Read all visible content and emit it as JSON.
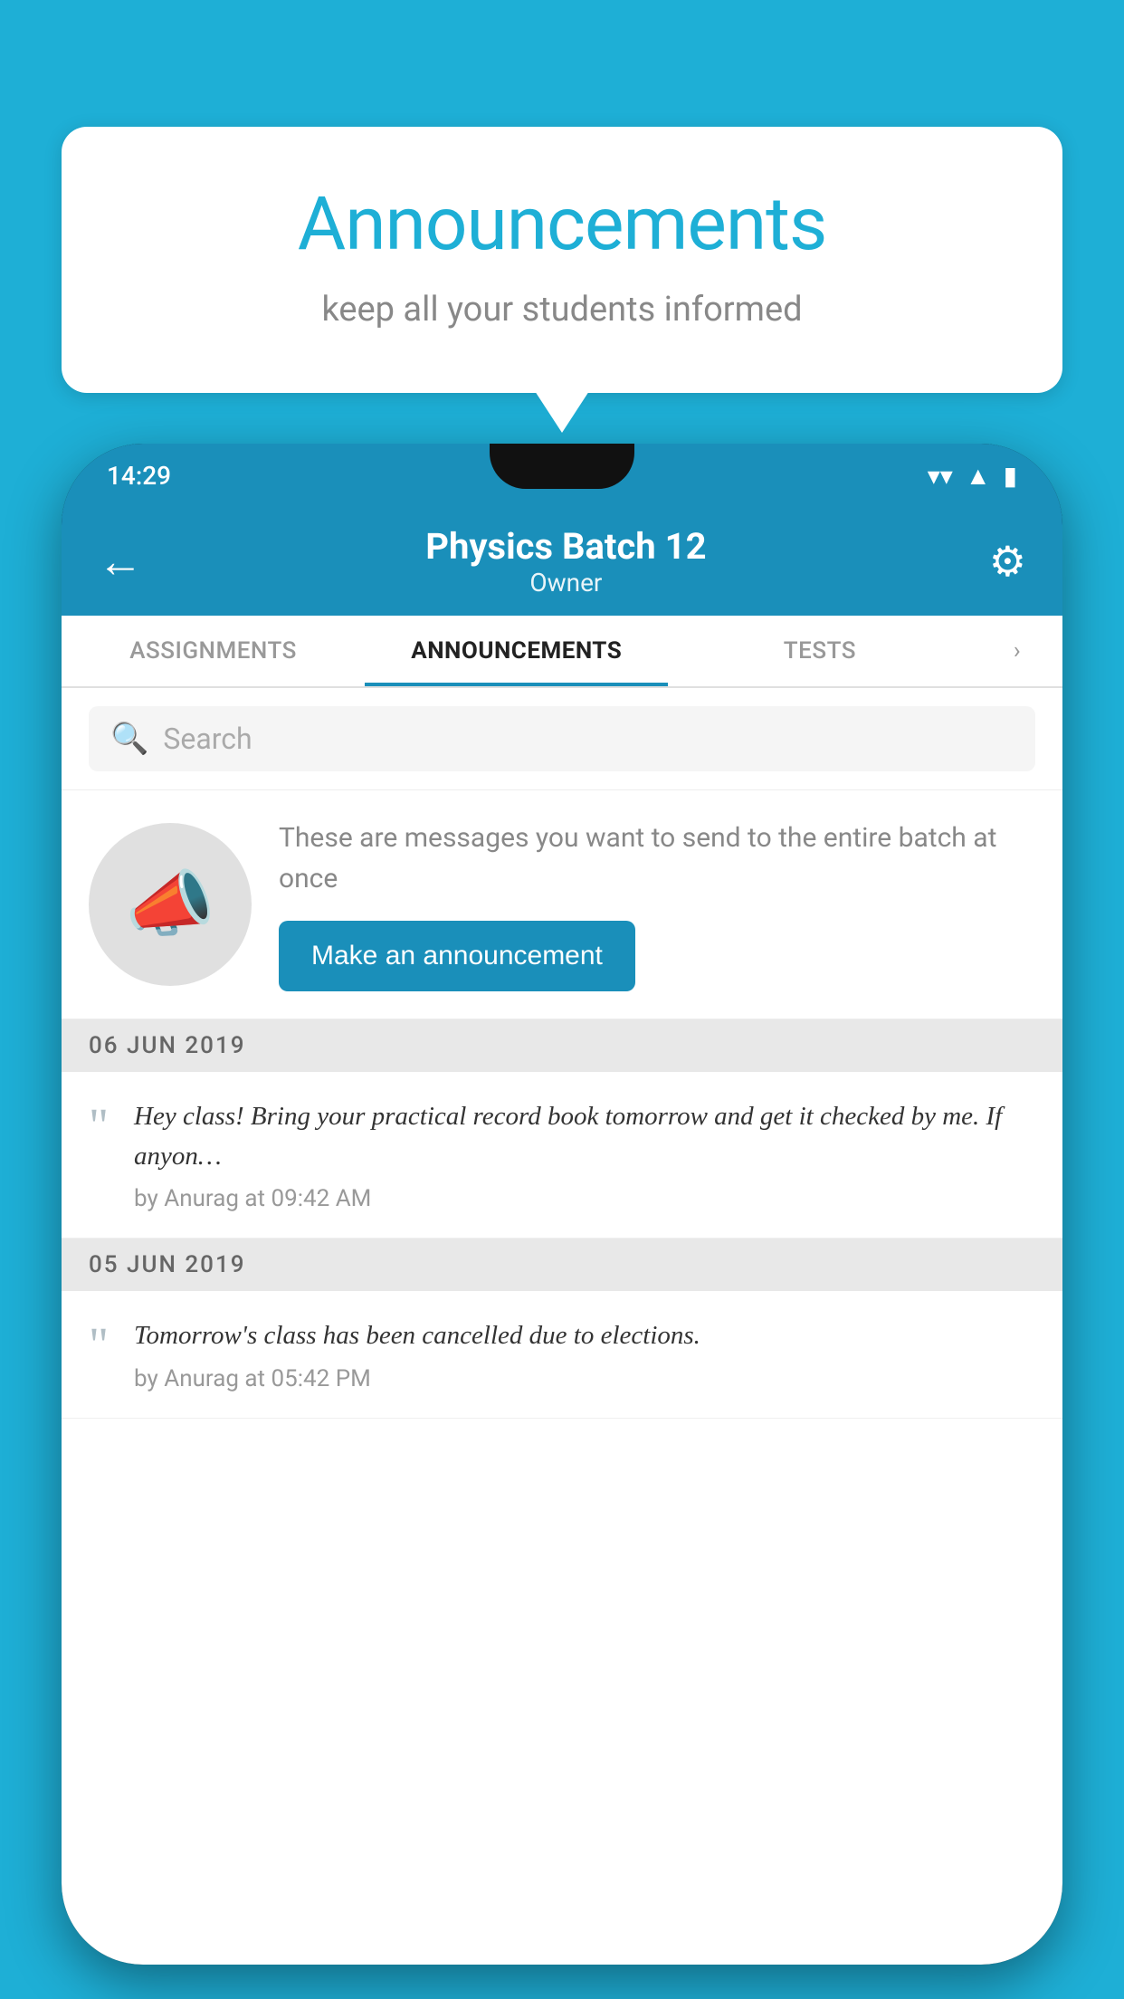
{
  "background_color": "#1EAFD6",
  "speech_bubble": {
    "title": "Announcements",
    "subtitle": "keep all your students informed"
  },
  "status_bar": {
    "time": "14:29",
    "wifi": "▾",
    "signal": "▴",
    "battery": "▮"
  },
  "header": {
    "title": "Physics Batch 12",
    "subtitle": "Owner",
    "back_label": "←",
    "gear_label": "⚙"
  },
  "tabs": [
    {
      "label": "ASSIGNMENTS",
      "active": false
    },
    {
      "label": "ANNOUNCEMENTS",
      "active": true
    },
    {
      "label": "TESTS",
      "active": false
    }
  ],
  "search": {
    "placeholder": "Search"
  },
  "promo": {
    "description": "These are messages you want to send to the entire batch at once",
    "button_label": "Make an announcement"
  },
  "announcements": [
    {
      "date": "06  JUN  2019",
      "text": "Hey class! Bring your practical record book tomorrow and get it checked by me. If anyon…",
      "meta": "by Anurag at 09:42 AM"
    },
    {
      "date": "05  JUN  2019",
      "text": "Tomorrow's class has been cancelled due to elections.",
      "meta": "by Anurag at 05:42 PM"
    }
  ]
}
